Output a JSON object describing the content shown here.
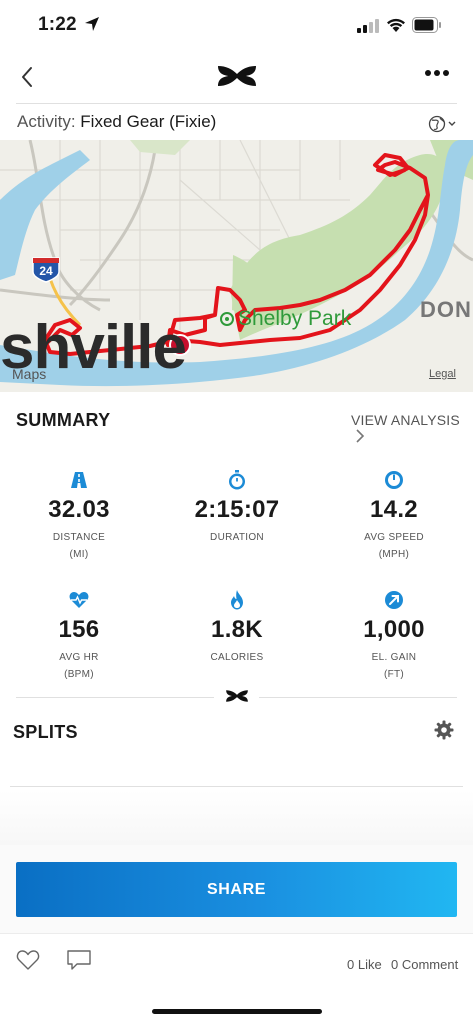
{
  "status_bar": {
    "time": "1:22"
  },
  "activity": {
    "prefix": "Activity:",
    "value": "Fixed Gear (Fixie)"
  },
  "map": {
    "city_label": "shville",
    "park_label": "Shelby Park",
    "area_label": "DON",
    "highway_shield": "24",
    "maps_attribution": "Maps",
    "legal": "Legal",
    "route_color": "#e3141b",
    "park_color": "#2f9a3a"
  },
  "summary": {
    "title": "SUMMARY",
    "view_analysis": "VIEW ANALYSIS",
    "stats": [
      {
        "icon": "road-icon",
        "value": "32.03",
        "label": "DISTANCE",
        "unit": "(MI)"
      },
      {
        "icon": "stopwatch-icon",
        "value": "2:15:07",
        "label": "DURATION",
        "unit": ""
      },
      {
        "icon": "speedometer-icon",
        "value": "14.2",
        "label": "AVG SPEED",
        "unit": "(MPH)"
      },
      {
        "icon": "heart-rate-icon",
        "value": "156",
        "label": "AVG HR",
        "unit": "(BPM)"
      },
      {
        "icon": "flame-icon",
        "value": "1.8K",
        "label": "CALORIES",
        "unit": ""
      },
      {
        "icon": "elevation-arrow-icon",
        "value": "1,000",
        "label": "EL. GAIN",
        "unit": "(FT)"
      }
    ]
  },
  "splits": {
    "title": "SPLITS"
  },
  "share": {
    "label": "SHARE"
  },
  "social": {
    "likes": "0 Like",
    "comments": "0 Comment"
  },
  "colors": {
    "accent": "#1a8fe0",
    "icon_blue": "#1c8bd6"
  }
}
